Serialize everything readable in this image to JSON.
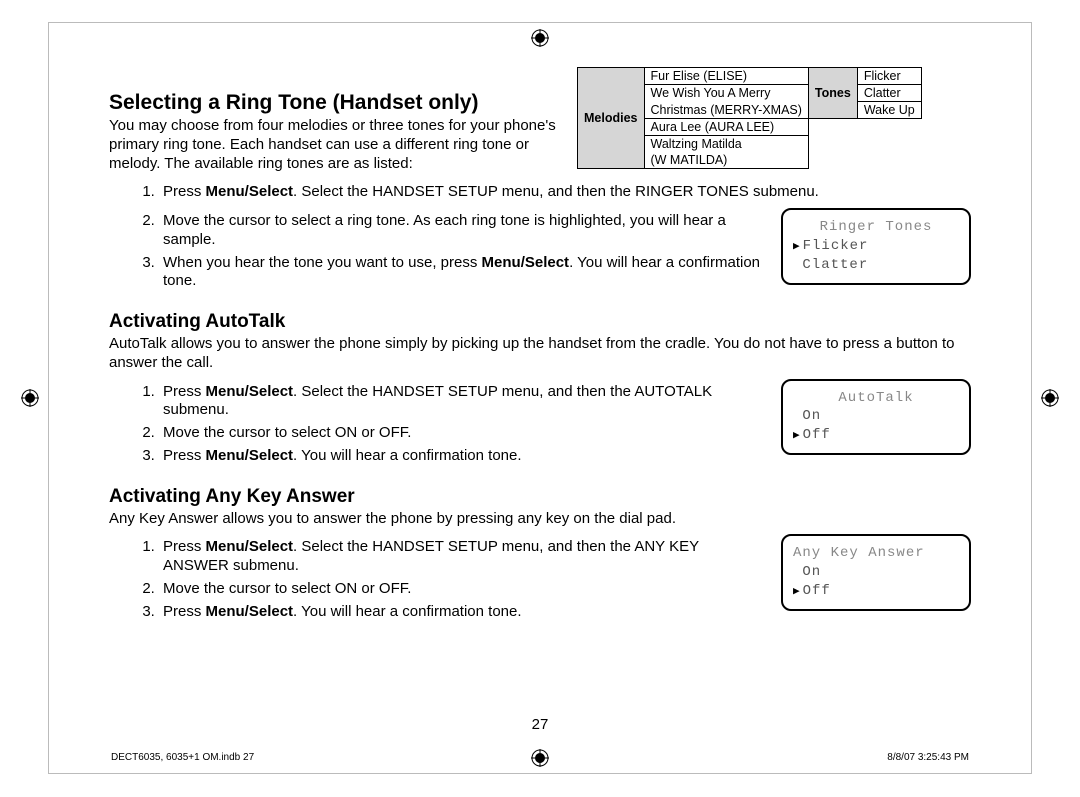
{
  "section1": {
    "heading": "Selecting a Ring Tone (Handset only)",
    "intro": "You may choose from four melodies or three tones for your phone's primary ring tone. Each handset can use a different ring tone or melody. The available ring tones are as listed:",
    "table": {
      "melodies_header": "Melodies",
      "tones_header": "Tones",
      "melodies": [
        "Fur Elise (ELISE)",
        "We Wish You A Merry",
        "Christmas (MERRY-XMAS)",
        "Aura Lee (AURA LEE)",
        "Waltzing Matilda",
        "(W MATILDA)"
      ],
      "tones": [
        "Flicker",
        "Clatter",
        "Wake Up"
      ]
    },
    "steps": [
      {
        "pre": "Press ",
        "bold": "Menu/Select",
        "post": ". Select the HANDSET SETUP menu, and then the RINGER TONES submenu."
      },
      {
        "pre": "",
        "bold": "",
        "post": "Move the cursor to select a ring tone. As each ring tone is highlighted, you will hear a sample."
      },
      {
        "pre": "When you hear the tone you want to use, press ",
        "bold": "Menu/Select",
        "post": ". You will hear a confirmation tone."
      }
    ],
    "lcd": {
      "title": "Ringer Tones",
      "rows": [
        {
          "cursor": true,
          "text": "Flicker"
        },
        {
          "cursor": false,
          "text": "Clatter"
        }
      ]
    }
  },
  "section2": {
    "heading": "Activating AutoTalk",
    "intro": "AutoTalk allows you to answer the phone simply by picking up the handset from the cradle. You do not have to press a button to answer the call.",
    "steps": [
      {
        "pre": "Press ",
        "bold": "Menu/Select",
        "post": ". Select the HANDSET SETUP menu, and then the AUTOTALK submenu."
      },
      {
        "pre": "",
        "bold": "",
        "post": "Move the cursor to select ON or OFF."
      },
      {
        "pre": "Press ",
        "bold": "Menu/Select",
        "post": ". You will hear a confirmation tone."
      }
    ],
    "lcd": {
      "title": "AutoTalk",
      "rows": [
        {
          "cursor": false,
          "text": "On"
        },
        {
          "cursor": true,
          "text": "Off"
        }
      ]
    }
  },
  "section3": {
    "heading": "Activating Any Key Answer",
    "intro": "Any Key Answer allows you to answer the phone by pressing any key on the dial pad.",
    "steps": [
      {
        "pre": "Press ",
        "bold": "Menu/Select",
        "post": ". Select the HANDSET SETUP menu, and then the ANY KEY ANSWER submenu."
      },
      {
        "pre": "",
        "bold": "",
        "post": "Move the cursor to select ON or OFF."
      },
      {
        "pre": "Press ",
        "bold": "Menu/Select",
        "post": ". You will hear a confirmation tone."
      }
    ],
    "lcd": {
      "title": "Any Key Answer",
      "rows": [
        {
          "cursor": false,
          "text": "On"
        },
        {
          "cursor": true,
          "text": "Off"
        }
      ]
    }
  },
  "page_number": "27",
  "footer_left": "DECT6035, 6035+1 OM.indb   27",
  "footer_right": "8/8/07   3:25:43 PM"
}
